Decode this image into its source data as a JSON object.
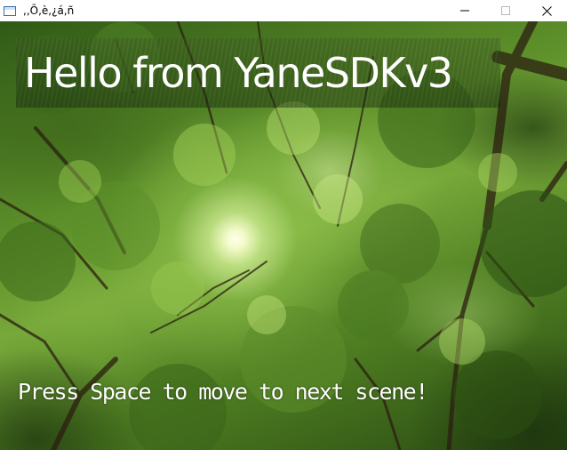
{
  "window": {
    "title": ",,Õ,è,¿á,ñ",
    "icon": "app-window-icon",
    "controls": {
      "minimize_icon": "minimize-icon",
      "maximize_icon": "maximize-icon",
      "close_icon": "close-icon"
    }
  },
  "scene": {
    "background": "forest-canopy-sunlight",
    "banner_text": "Hello from YaneSDKv3",
    "prompt_text": "Press Space to move to next scene!"
  },
  "colors": {
    "text": "#ffffff",
    "titlebar": "#ffffff",
    "foliage_dark": "#2a4a12",
    "foliage_light": "#77a83a"
  }
}
